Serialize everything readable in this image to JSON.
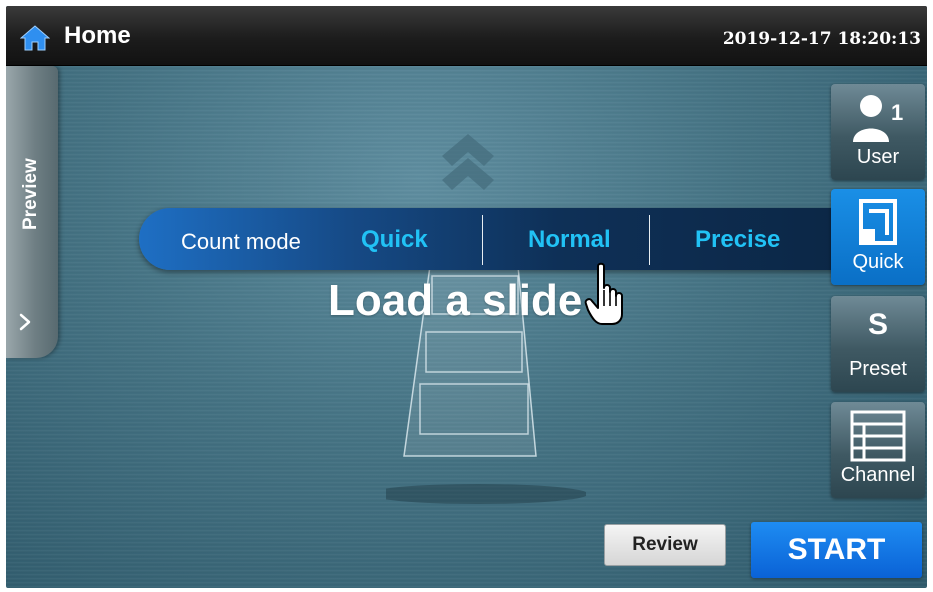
{
  "header": {
    "title": "Home",
    "datetime": "2019-12-17 18:20:13",
    "home_icon": "home-icon"
  },
  "side_tab": {
    "label": "Preview",
    "icon": "chevron-right-icon"
  },
  "count_mode": {
    "label": "Count mode",
    "options": [
      "Quick",
      "Normal",
      "Precise"
    ]
  },
  "main": {
    "message": "Load a slide"
  },
  "right_panel": {
    "user": {
      "label": "User",
      "badge": "1",
      "icon": "user-icon"
    },
    "quick": {
      "label": "Quick",
      "icon": "quick-mode-icon"
    },
    "preset": {
      "label": "Preset",
      "glyph": "S"
    },
    "channel": {
      "label": "Channel",
      "icon": "channel-list-icon"
    }
  },
  "actions": {
    "review": "Review",
    "start": "START"
  },
  "colors": {
    "accent_blue": "#0a6fc6",
    "mode_text": "#21c2f5",
    "background": "#457384"
  }
}
